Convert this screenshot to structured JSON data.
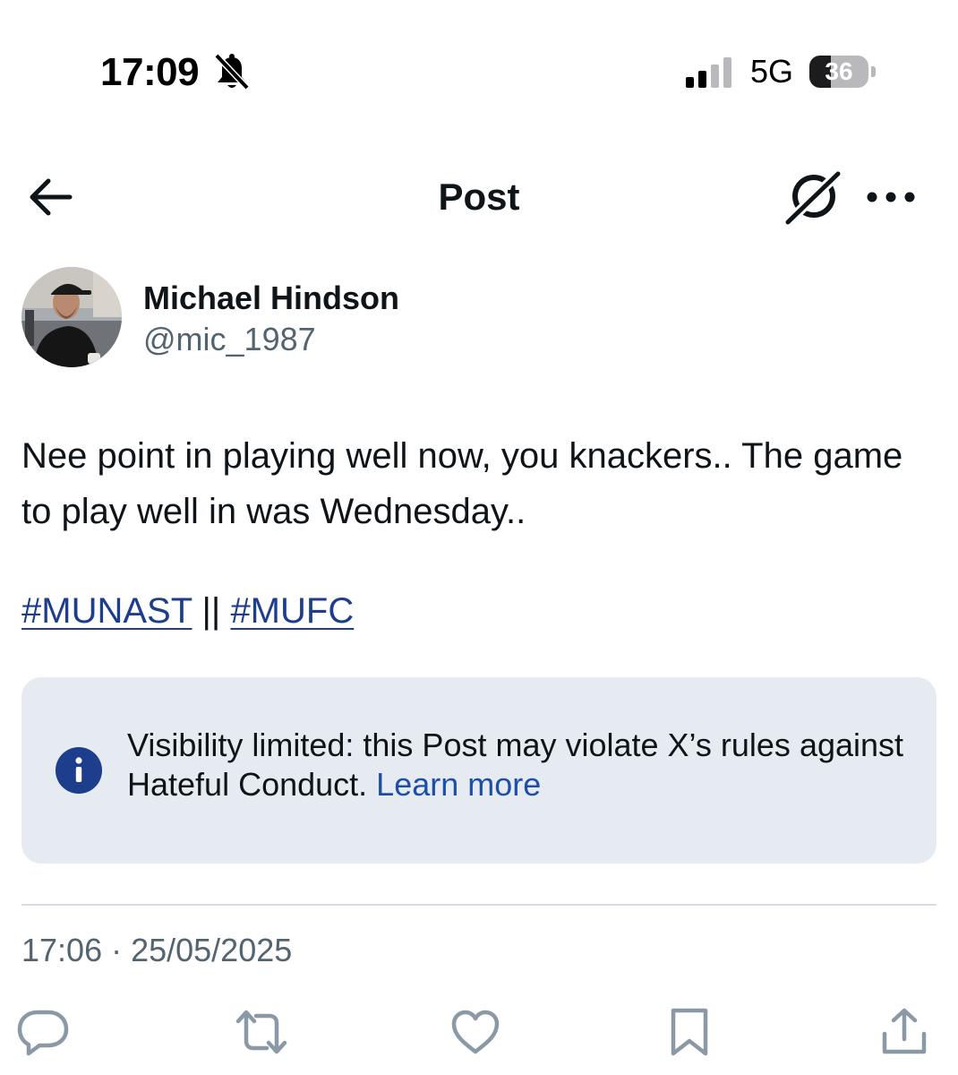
{
  "status_bar": {
    "time": "17:09",
    "network": "5G",
    "battery": "36"
  },
  "header": {
    "title": "Post"
  },
  "author": {
    "name": "Michael Hindson",
    "handle": "@mic_1987"
  },
  "post": {
    "text": "Nee point in playing well now, you knackers.. The game to play well in was Wednesday..",
    "hashtags": [
      "#MUNAST",
      "#MUFC"
    ],
    "separator": " || ",
    "timestamp": "17:06 · 25/05/2025"
  },
  "notice": {
    "text": "Visibility limited: this Post may violate X’s rules against Hateful Conduct.",
    "link": "Learn more"
  },
  "actions": [
    "reply-icon",
    "repost-icon",
    "like-icon",
    "bookmark-icon",
    "share-icon"
  ],
  "colors": {
    "text": "#0f1419",
    "secondary": "#536471",
    "link": "#1d4ea8",
    "notice_bg": "#e6ebf2",
    "icon": "#8b98a5"
  }
}
